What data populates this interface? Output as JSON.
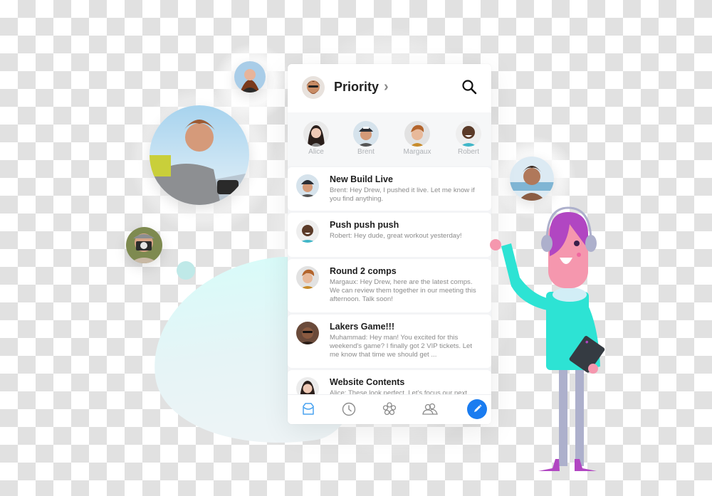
{
  "app": {
    "header": {
      "title": "Priority",
      "chevron_icon": "chevron-right-icon",
      "search_icon": "search-icon"
    },
    "contacts": [
      {
        "name": "Alice"
      },
      {
        "name": "Brent"
      },
      {
        "name": "Margaux"
      },
      {
        "name": "Robert"
      }
    ],
    "messages": [
      {
        "subject": "New Build Live",
        "preview": "Brent: Hey Drew, I pushed it live. Let me know if you find anything."
      },
      {
        "subject": "Push push push",
        "preview": "Robert: Hey dude, great workout yesterday!"
      },
      {
        "subject": "Round 2 comps",
        "preview": "Margaux: Hey Drew, here are the latest comps. We can review them together in our meeting this afternoon. Talk soon!"
      },
      {
        "subject": "Lakers Game!!!",
        "preview": "Muhammad: Hey man! You excited for this weekend's game? I finally got 2 VIP tickets. Let me know that time we should get ..."
      },
      {
        "subject": "Website Contents",
        "preview": "Alice: These look perfect. Let's focus our next"
      }
    ],
    "tabbar": [
      {
        "icon": "inbox-icon"
      },
      {
        "icon": "clock-icon"
      },
      {
        "icon": "flower-icon"
      },
      {
        "icon": "people-icon"
      },
      {
        "icon": "pencil-icon"
      }
    ]
  },
  "colors": {
    "accent": "#1a7cf0",
    "character_shirt": "#2de3d4",
    "character_hair": "#b146c2",
    "character_skin": "#f597ae",
    "blob": "#dcf8f7"
  }
}
